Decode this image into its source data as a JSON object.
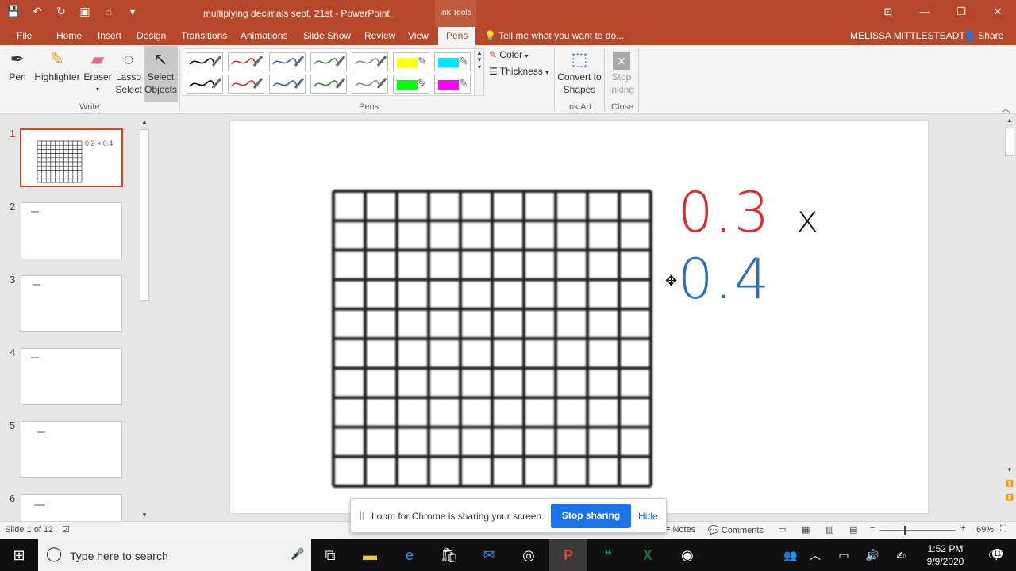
{
  "titlebar": {
    "doc_title": "multiplying decimals sept. 21st - PowerPoint",
    "context_tab": "Ink Tools",
    "qat_icons": [
      "save-icon",
      "undo-icon",
      "redo-icon",
      "present-icon",
      "touch-icon",
      "customize-icon"
    ]
  },
  "tabs": [
    "File",
    "Home",
    "Insert",
    "Design",
    "Transitions",
    "Animations",
    "Slide Show",
    "Review",
    "View",
    "Pens"
  ],
  "active_tab": "Pens",
  "tellme": "Tell me what you want to do...",
  "user": "MELISSA MITTLESTEADT",
  "share": "Share",
  "ribbon": {
    "write": {
      "pen": "Pen",
      "highlighter": "Highlighter",
      "eraser": "Eraser",
      "lasso": "Lasso Select",
      "select": "Select Objects",
      "label": "Write"
    },
    "pens_label": "Pens",
    "pen_colors": [
      "#000000",
      "#d62f2f",
      "#2f5fb7",
      "#2e8b3c",
      "#8a8a8a",
      "#ffff00",
      "#00e5ff",
      "#000000",
      "#d62f2f",
      "#2f5fb7",
      "#2e8b3c",
      "#8a8a8a",
      "#00ff00",
      "#ff00ff"
    ],
    "color_label": "Color",
    "thickness_label": "Thickness",
    "convert": "Convert to Shapes",
    "ink_art": "Ink Art",
    "stop": "Stop Inking",
    "close": "Close"
  },
  "slides": {
    "numbers": [
      "1",
      "2",
      "3",
      "4",
      "5",
      "6"
    ],
    "thumb1_text": "0.3 × 0.4"
  },
  "slide": {
    "n1": "0.3",
    "times": "x",
    "n2": "0.4",
    "colors": {
      "red": "#d62f2f",
      "blue": "#2f6fb7"
    }
  },
  "status": {
    "slide_of": "Slide 1 of 12",
    "notes": "Notes",
    "comments": "Comments",
    "zoom": "69%"
  },
  "loom": {
    "text": "Loom for Chrome is sharing your screen.",
    "stop": "Stop sharing",
    "hide": "Hide"
  },
  "taskbar": {
    "search": "Type here to search",
    "time": "1:52 PM",
    "date": "9/9/2020",
    "notif": "11"
  }
}
